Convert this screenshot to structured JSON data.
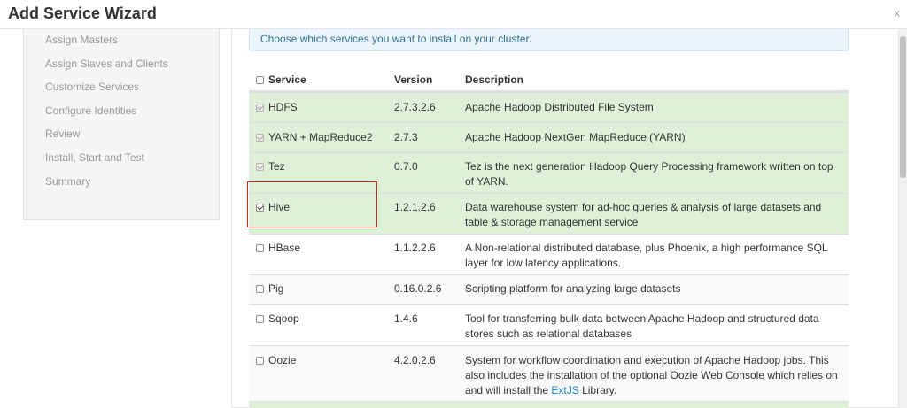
{
  "window": {
    "title": "Add Service Wizard",
    "close_label": "x"
  },
  "sidebar": {
    "items": [
      {
        "label": "Assign Masters"
      },
      {
        "label": "Assign Slaves and Clients"
      },
      {
        "label": "Customize Services"
      },
      {
        "label": "Configure Identities"
      },
      {
        "label": "Review"
      },
      {
        "label": "Install, Start and Test"
      },
      {
        "label": "Summary"
      }
    ]
  },
  "main": {
    "info_text": "Choose which services you want to install on your cluster.",
    "table": {
      "headers": {
        "service": "Service",
        "version": "Version",
        "description": "Description"
      },
      "rows": [
        {
          "service": "HDFS",
          "version": "2.7.3.2.6",
          "description": "Apache Hadoop Distributed File System",
          "checked": true,
          "disabled": true
        },
        {
          "service": "YARN + MapReduce2",
          "version": "2.7.3",
          "description": "Apache Hadoop NextGen MapReduce (YARN)",
          "checked": true,
          "disabled": true
        },
        {
          "service": "Tez",
          "version": "0.7.0",
          "description": "Tez is the next generation Hadoop Query Processing framework written on top of YARN.",
          "checked": true,
          "disabled": true
        },
        {
          "service": "Hive",
          "version": "1.2.1.2.6",
          "description": "Data warehouse system for ad-hoc queries & analysis of large datasets and table & storage management service",
          "checked": true,
          "disabled": false
        },
        {
          "service": "HBase",
          "version": "1.1.2.2.6",
          "description": "A Non-relational distributed database, plus Phoenix, a high performance SQL layer for low latency applications.",
          "checked": false,
          "disabled": false
        },
        {
          "service": "Pig",
          "version": "0.16.0.2.6",
          "description": "Scripting platform for analyzing large datasets",
          "checked": false,
          "disabled": false
        },
        {
          "service": "Sqoop",
          "version": "1.4.6",
          "description": "Tool for transferring bulk data between Apache Hadoop and structured data stores such as relational databases",
          "checked": false,
          "disabled": false
        },
        {
          "service": "Oozie",
          "version": "4.2.0.2.6",
          "description_before_link": "System for workflow coordination and execution of Apache Hadoop jobs. This also includes the installation of the optional Oozie Web Console which relies on and will install the ",
          "description_link": "ExtJS",
          "description_after_link": " Library.",
          "checked": false,
          "disabled": false
        }
      ]
    }
  },
  "colors": {
    "selected_row": "#dff0d8",
    "highlight_box": "#e0201c",
    "info_bg": "#eaf5fb",
    "link": "#1a85c5"
  }
}
